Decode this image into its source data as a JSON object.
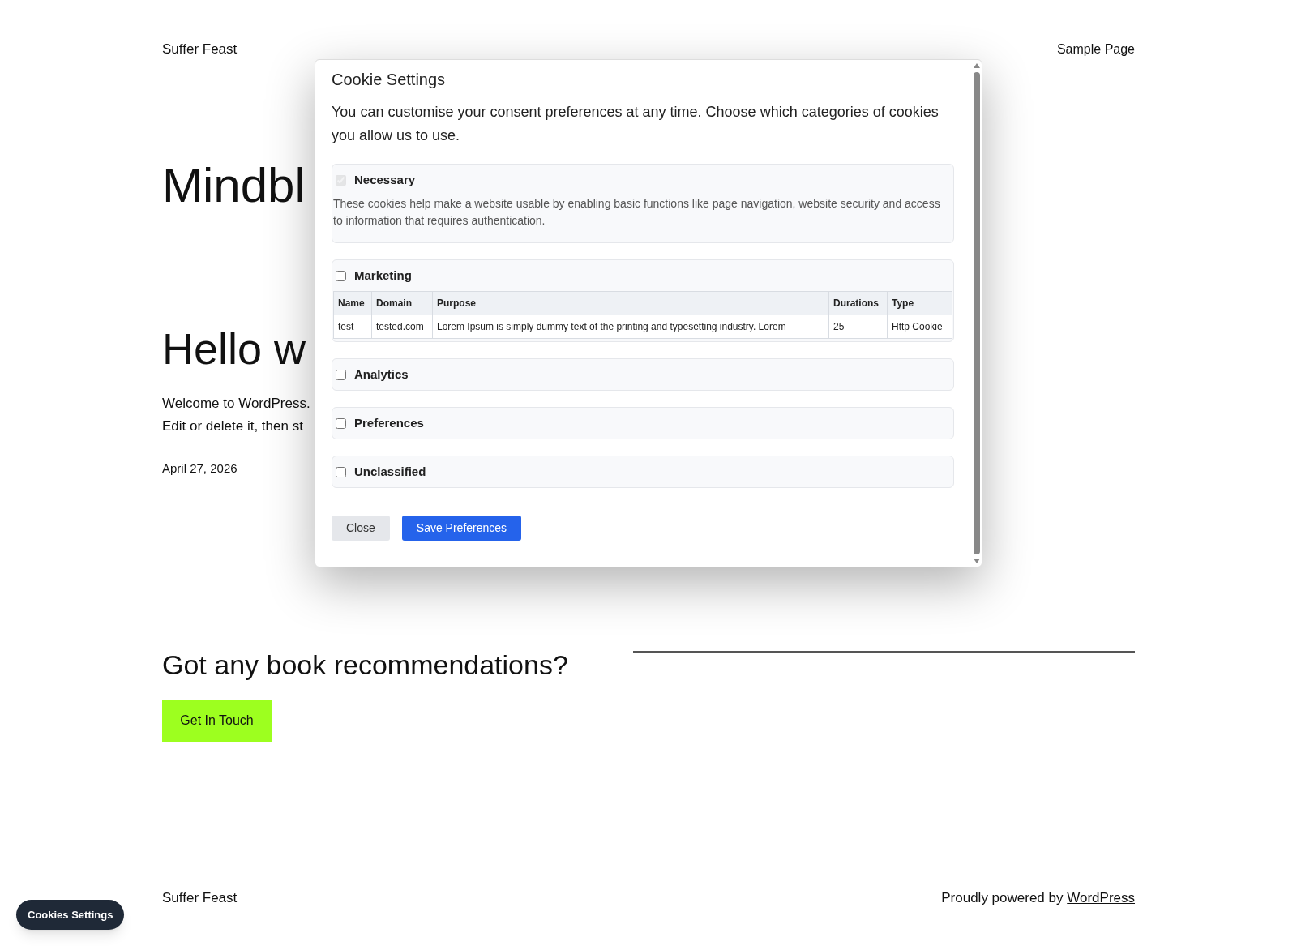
{
  "site_title": "Suffer Feast",
  "nav": [
    {
      "label": "Sample Page"
    }
  ],
  "hero_heading": "Mindbl",
  "post": {
    "title": "Hello w",
    "paragraph_lines": [
      "Welcome to WordPress.",
      "Edit or delete it, then st"
    ],
    "date": "April 27, 2026"
  },
  "cta": {
    "heading": "Got any book recommendations?",
    "button": "Get In Touch"
  },
  "footer": {
    "site_title": "Suffer Feast",
    "credit": "Proudly powered by ",
    "credit_link": "WordPress"
  },
  "cookie_button": "Cookies Settings",
  "modal": {
    "title": "Cookie Settings",
    "description": "You can customise your consent preferences at any time. Choose which categories of cookies you allow us to use.",
    "categories": [
      {
        "name": "Necessary",
        "checked": true,
        "disabled": true,
        "description": "These cookies help make a website usable by enabling basic functions like page navigation, website security and access to information that requires authentication."
      },
      {
        "name": "Marketing",
        "checked": false,
        "disabled": false,
        "table": {
          "columns": [
            "Name",
            "Domain",
            "Purpose",
            "Durations",
            "Type"
          ],
          "rows": [
            [
              "test",
              "tested.com",
              "Lorem Ipsum is simply dummy text of the printing and typesetting industry. Lorem",
              "25",
              "Http Cookie"
            ]
          ]
        }
      },
      {
        "name": "Analytics",
        "checked": false,
        "disabled": false
      },
      {
        "name": "Preferences",
        "checked": false,
        "disabled": false
      },
      {
        "name": "Unclassified",
        "checked": false,
        "disabled": false
      }
    ],
    "buttons": [
      {
        "label": "Close",
        "kind": "secondary"
      },
      {
        "label": "Save Preferences",
        "kind": "primary"
      }
    ]
  }
}
